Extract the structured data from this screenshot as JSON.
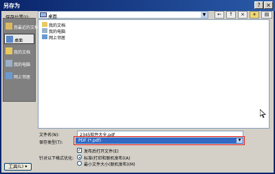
{
  "dialog": {
    "title": "另存为"
  },
  "toolbar": {
    "save_in_label": "保存位置(I):",
    "location": "桌面"
  },
  "places": [
    {
      "label": "我最近的文档"
    },
    {
      "label": "桌面"
    },
    {
      "label": "我的文档"
    },
    {
      "label": "我的电脑"
    },
    {
      "label": "网上邻居"
    }
  ],
  "files": [
    {
      "name": "我的文档"
    },
    {
      "name": "我的电脑"
    },
    {
      "name": "网上邻居"
    }
  ],
  "form": {
    "filename_label": "文件名(N):",
    "filename_value": "2345软件大全.pdf",
    "filetype_label": "保存类型(T):",
    "filetype_value": "PDF (*.pdf)",
    "open_after_publish_label": "发布后打开文件(E)",
    "optimize_label": "针对以下格式优化:",
    "opt_standard_label": "标准(打印和联机发布)(A)",
    "opt_min_label": "最小文件大小(联机发布)(M)"
  },
  "buttons": {
    "tools": "工具(L)"
  },
  "colors": {
    "highlight": "#316ac5",
    "annotation_box": "#e01818"
  }
}
